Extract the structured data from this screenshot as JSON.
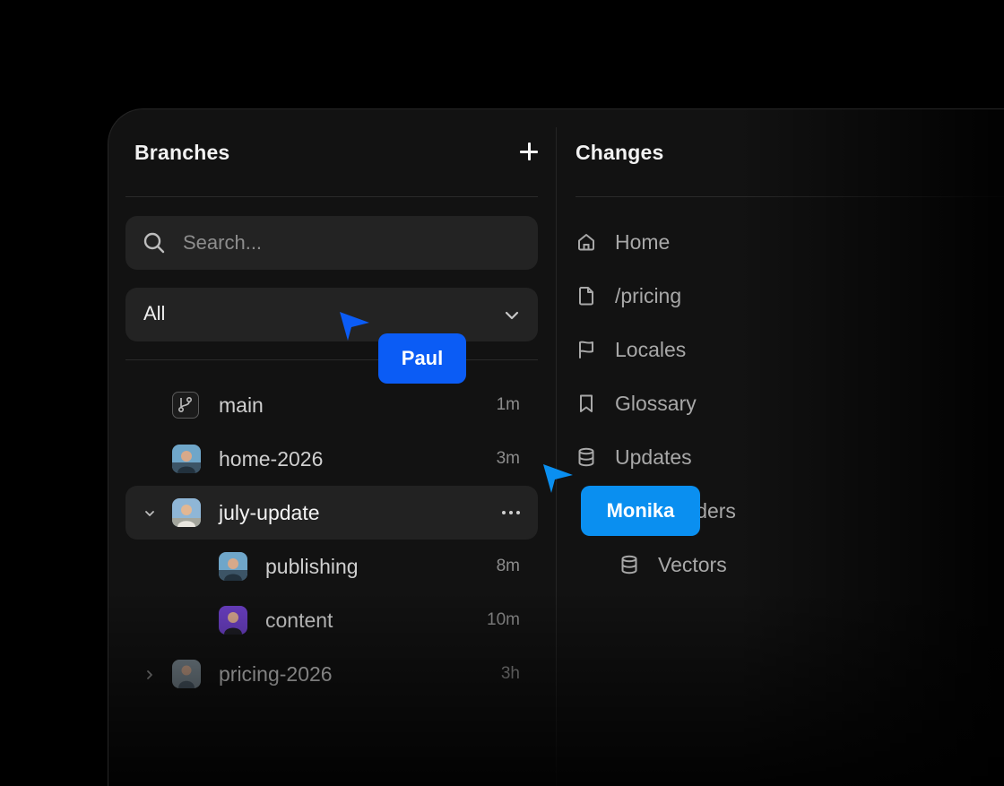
{
  "branches_panel": {
    "title": "Branches",
    "search_placeholder": "Search...",
    "filter_value": "All",
    "items": [
      {
        "name": "main",
        "time": "1m"
      },
      {
        "name": "home-2026",
        "time": "3m"
      },
      {
        "name": "july-update"
      },
      {
        "name": "publishing",
        "time": "8m"
      },
      {
        "name": "content",
        "time": "10m"
      },
      {
        "name": "pricing-2026",
        "time": "3h"
      }
    ]
  },
  "changes_panel": {
    "title": "Changes",
    "items": [
      {
        "label": "Home",
        "icon": "home-icon"
      },
      {
        "label": "/pricing",
        "icon": "file-icon"
      },
      {
        "label": "Locales",
        "icon": "flag-icon"
      },
      {
        "label": "Glossary",
        "icon": "bookmark-icon"
      },
      {
        "label": "Updates",
        "icon": "database-icon"
      },
      {
        "label": "Headers",
        "icon": "database-icon"
      },
      {
        "label": "Vectors",
        "icon": "database-icon"
      }
    ]
  },
  "collaborators": [
    {
      "name": "Paul",
      "color": "#0b5cf5"
    },
    {
      "name": "Monika",
      "color": "#0a8ff0"
    }
  ],
  "colors": {
    "window_bg": "#121212",
    "field_bg": "#232323",
    "active_row_bg": "#222222"
  }
}
